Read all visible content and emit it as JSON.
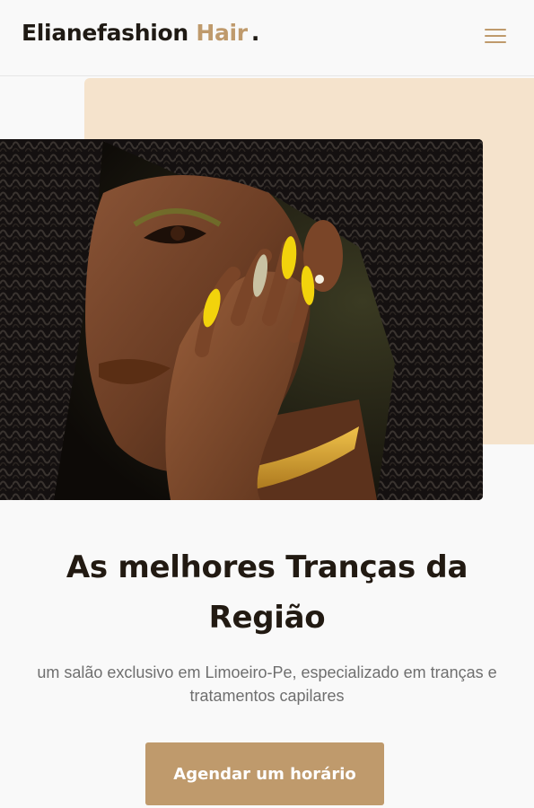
{
  "header": {
    "brand_main": "Elianefashion",
    "brand_accent": "Hair",
    "brand_dot": ".",
    "menu_icon": "hamburger-menu-icon"
  },
  "hero": {
    "image_alt": "woman with braids and yellow nails"
  },
  "main": {
    "headline": "As melhores Tranças da Região",
    "subtitle": "um salão exclusivo em Limoeiro-Pe, especializado em tranças e tratamentos capilares",
    "cta_label": "Agendar um horário"
  },
  "colors": {
    "accent": "#bf9a6c",
    "hero_backdrop": "#f5e3cc",
    "heading": "#221a12",
    "body_text": "#6f6f6f"
  }
}
